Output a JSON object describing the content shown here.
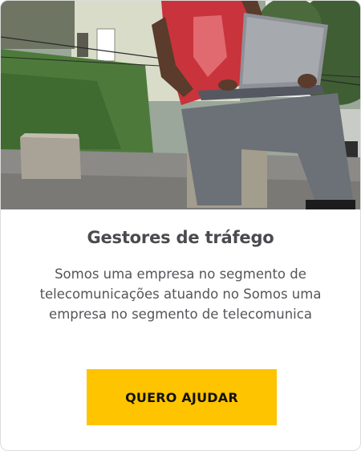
{
  "card": {
    "image_alt": "person-with-laptop-photo",
    "title": "Gestores de tráfego",
    "description": "Somos uma empresa no segmento de telecomunicações atuando no Somos uma empresa no segmento de telecomunica",
    "button_label": "QUERO AJUDAR"
  },
  "colors": {
    "accent": "#ffc400",
    "title": "#4a4a4f",
    "text": "#55555a"
  }
}
